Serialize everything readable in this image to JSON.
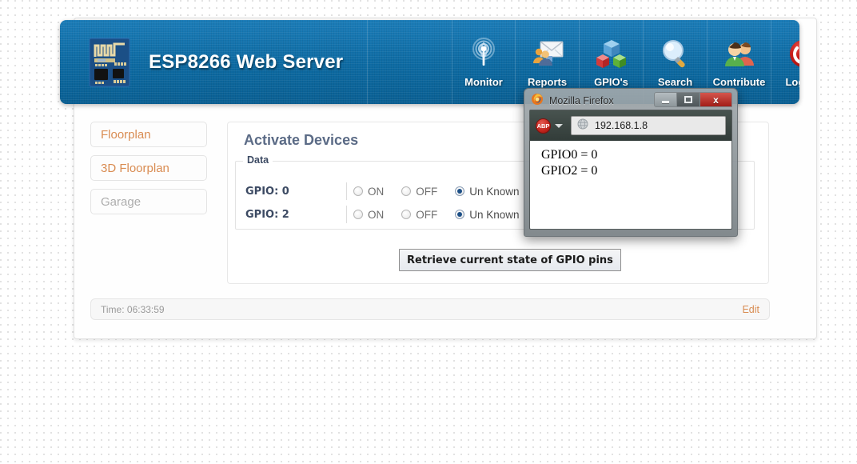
{
  "header": {
    "brand_title": "ESP8266 Web Server",
    "logo_icon": "esp8266-module-icon",
    "nav": [
      {
        "label": "Monitor",
        "icon": "wifi-signal-icon"
      },
      {
        "label": "Reports",
        "icon": "envelope-users-icon"
      },
      {
        "label": "GPIO's",
        "icon": "colored-cubes-icon"
      },
      {
        "label": "Search",
        "icon": "magnifier-icon"
      },
      {
        "label": "Contribute",
        "icon": "two-people-icon"
      },
      {
        "label": "Logout",
        "icon": "power-button-icon"
      }
    ]
  },
  "sidebar": {
    "items": [
      {
        "label": "Floorplan",
        "state": "link"
      },
      {
        "label": "3D Floorplan",
        "state": "link"
      },
      {
        "label": "Garage",
        "state": "disabled"
      }
    ]
  },
  "main": {
    "panel_title": "Activate Devices",
    "fieldset_legend": "Data",
    "radio_options": [
      "ON",
      "OFF",
      "Un Known"
    ],
    "rows": [
      {
        "label": "GPIO: 0",
        "selected": "Un Known"
      },
      {
        "label": "GPIO: 2",
        "selected": "Un Known"
      }
    ],
    "retrieve_button": "Retrieve current state of GPIO pins"
  },
  "footer": {
    "time_label": "Time: 06:33:59",
    "edit_label": "Edit"
  },
  "firefox_window": {
    "title": "Mozilla Firefox",
    "logo_icon": "firefox-logo-icon",
    "window_controls": {
      "minimize": "minimize-icon",
      "maximize": "maximize-icon",
      "close": "x"
    },
    "toolbar": {
      "abp_label": "ABP",
      "abp_icon": "adblock-plus-icon",
      "dropdown_icon": "chevron-down-icon",
      "site_icon": "globe-icon",
      "url": "192.168.1.8"
    },
    "content_lines": [
      "GPIO0 = 0",
      "GPIO2 = 0"
    ]
  },
  "colors": {
    "header_blue": "#0d6aa2",
    "link_orange": "#d98c52",
    "panel_title": "#5b6b86",
    "radio_selected": "#1c4f86",
    "close_red": "#a21d18"
  }
}
